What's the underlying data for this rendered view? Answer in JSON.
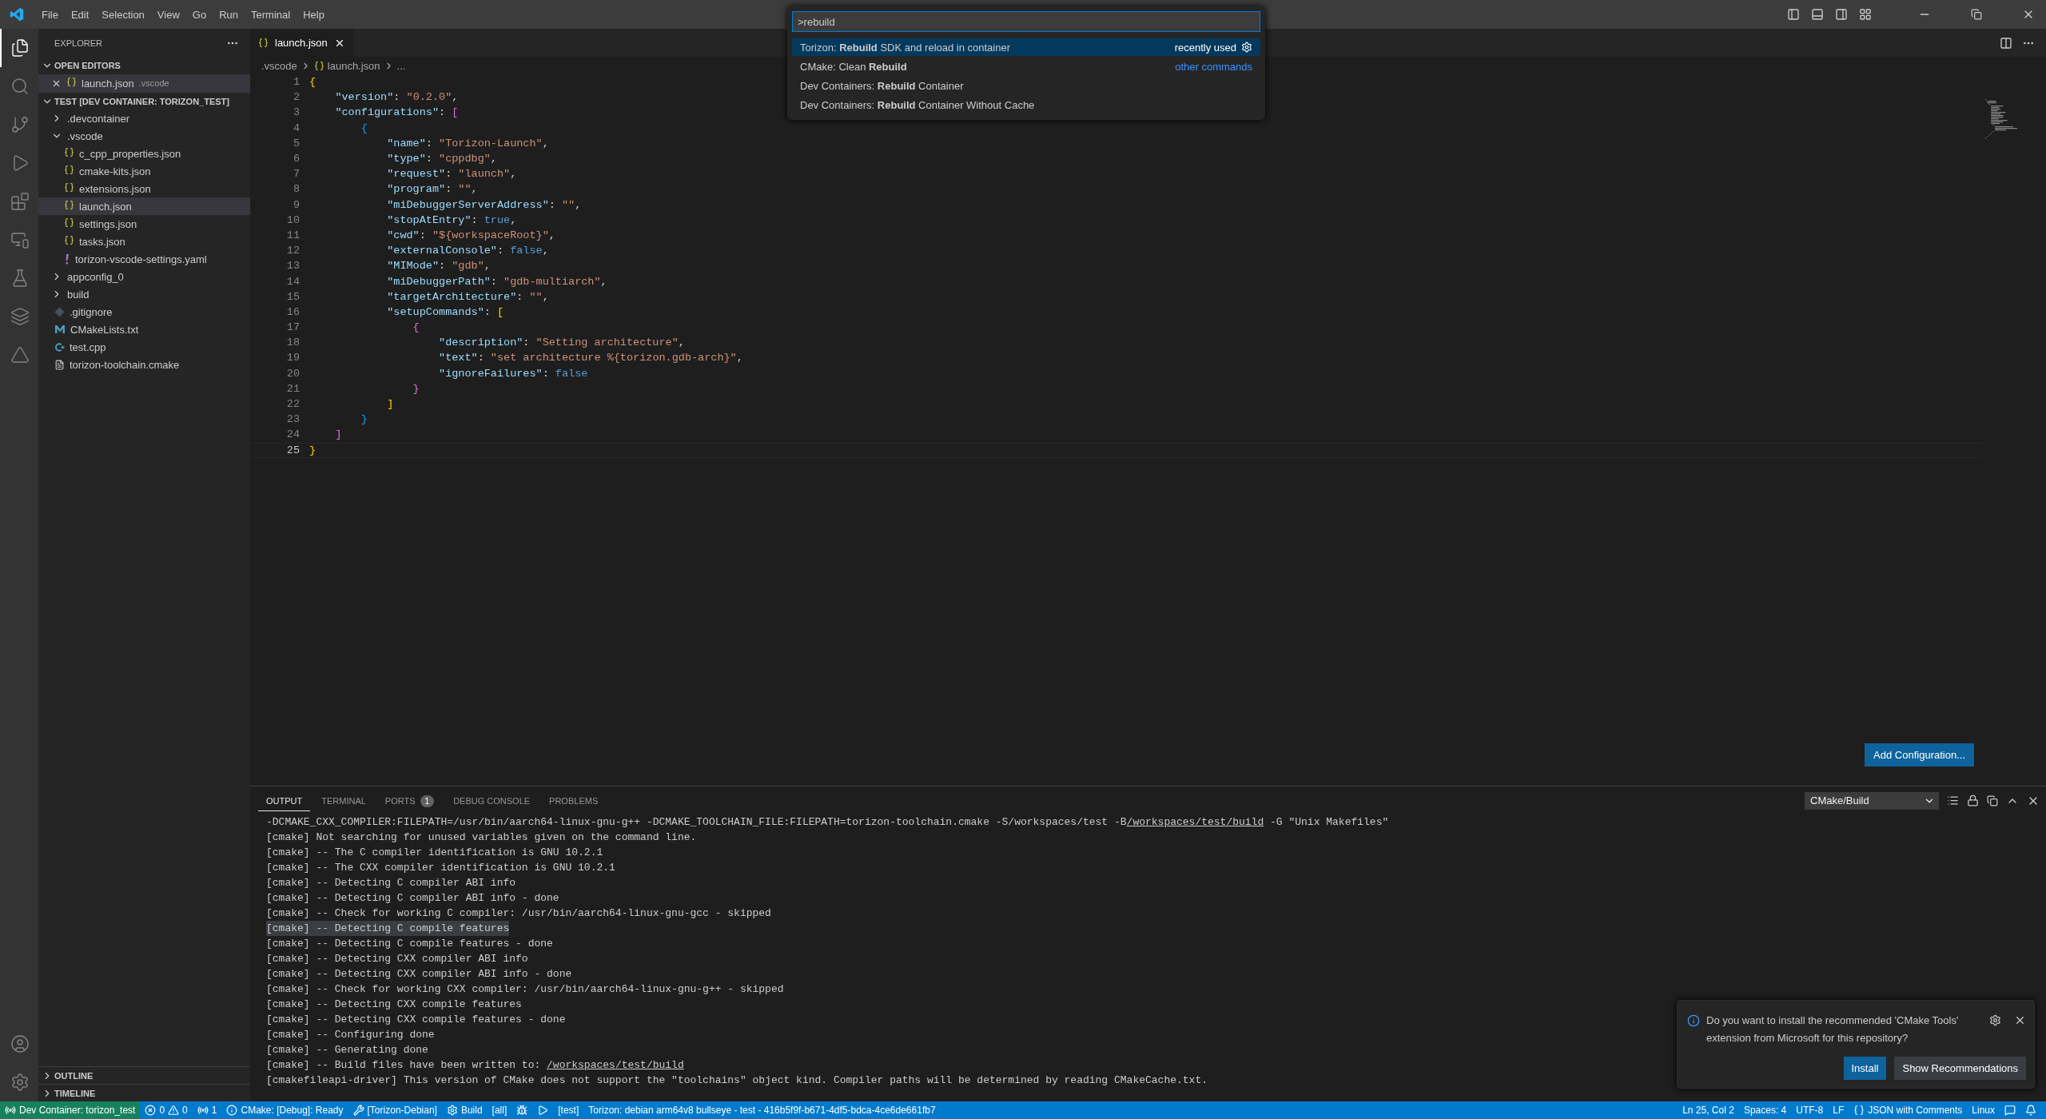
{
  "menu": [
    "File",
    "Edit",
    "Selection",
    "View",
    "Go",
    "Run",
    "Terminal",
    "Help"
  ],
  "activity_bar": {
    "top": [
      {
        "kind": "files",
        "selected": true
      },
      {
        "kind": "search",
        "selected": false
      },
      {
        "kind": "source-control",
        "selected": false
      },
      {
        "kind": "run-debug",
        "selected": false
      },
      {
        "kind": "extensions",
        "selected": false
      },
      {
        "kind": "remote",
        "selected": false
      },
      {
        "kind": "testing",
        "selected": false
      },
      {
        "kind": "stack",
        "selected": false
      },
      {
        "kind": "torizon",
        "selected": false
      }
    ],
    "bottom": [
      {
        "kind": "account"
      },
      {
        "kind": "settings"
      }
    ]
  },
  "sidebar": {
    "title": "EXPLORER",
    "open_editors": {
      "title": "OPEN EDITORS",
      "items": [
        {
          "name": "launch.json",
          "folder": ".vscode",
          "kind": "json"
        }
      ]
    },
    "folder": {
      "title": "TEST [DEV CONTAINER: TORIZON_TEST]",
      "items": [
        {
          "name": ".devcontainer",
          "kind": "folder",
          "expanded": false,
          "selected": false
        },
        {
          "name": ".vscode",
          "kind": "folder",
          "expanded": true,
          "selected": false,
          "children": [
            {
              "name": "c_cpp_properties.json",
              "kind": "json",
              "selected": false
            },
            {
              "name": "cmake-kits.json",
              "kind": "json",
              "selected": false
            },
            {
              "name": "extensions.json",
              "kind": "json",
              "selected": false
            },
            {
              "name": "launch.json",
              "kind": "json",
              "selected": true
            },
            {
              "name": "settings.json",
              "kind": "json",
              "selected": false
            },
            {
              "name": "tasks.json",
              "kind": "json",
              "selected": false
            },
            {
              "name": "torizon-vscode-settings.yaml",
              "kind": "yaml",
              "selected": false
            }
          ]
        },
        {
          "name": "appconfig_0",
          "kind": "folder",
          "expanded": false,
          "selected": false
        },
        {
          "name": "build",
          "kind": "folder",
          "expanded": false,
          "selected": false
        },
        {
          "name": ".gitignore",
          "kind": "git",
          "selected": false
        },
        {
          "name": "CMakeLists.txt",
          "kind": "cmake",
          "selected": false
        },
        {
          "name": "test.cpp",
          "kind": "cpp",
          "selected": false
        },
        {
          "name": "torizon-toolchain.cmake",
          "kind": "text",
          "selected": false
        }
      ]
    },
    "sections": [
      {
        "title": "OUTLINE",
        "expanded": false
      },
      {
        "title": "TIMELINE",
        "expanded": false
      }
    ]
  },
  "editor": {
    "tabs": [
      {
        "label": "launch.json",
        "selected": true
      }
    ],
    "breadcrumbs": [
      ".vscode",
      "launch.json",
      "..."
    ],
    "lines": [
      {
        "number": "1",
        "current": false,
        "tokens": [
          {
            "kind": "bracket",
            "color": "#ffd700",
            "text": "{"
          }
        ]
      },
      {
        "number": "2",
        "current": false,
        "tokens": [
          {
            "kind": "key",
            "text": "    \"version\""
          },
          {
            "kind": "punc",
            "text": ": "
          },
          {
            "kind": "str",
            "text": "\"0.2.0\""
          },
          {
            "kind": "punc",
            "text": ","
          }
        ]
      },
      {
        "number": "3",
        "current": false,
        "tokens": [
          {
            "kind": "key",
            "text": "    \"configurations\""
          },
          {
            "kind": "punc",
            "text": ": "
          },
          {
            "kind": "bracket",
            "color": "#da70d6",
            "text": "["
          }
        ]
      },
      {
        "number": "4",
        "current": false,
        "tokens": [
          {
            "kind": "bracket",
            "color": "#179fff",
            "text": "        {"
          }
        ]
      },
      {
        "number": "5",
        "current": false,
        "tokens": [
          {
            "kind": "key",
            "text": "            \"name\""
          },
          {
            "kind": "punc",
            "text": ": "
          },
          {
            "kind": "str",
            "text": "\"Torizon-Launch\""
          },
          {
            "kind": "punc",
            "text": ","
          }
        ]
      },
      {
        "number": "6",
        "current": false,
        "tokens": [
          {
            "kind": "key",
            "text": "            \"type\""
          },
          {
            "kind": "punc",
            "text": ": "
          },
          {
            "kind": "str",
            "text": "\"cppdbg\""
          },
          {
            "kind": "punc",
            "text": ","
          }
        ]
      },
      {
        "number": "7",
        "current": false,
        "tokens": [
          {
            "kind": "key",
            "text": "            \"request\""
          },
          {
            "kind": "punc",
            "text": ": "
          },
          {
            "kind": "str",
            "text": "\"launch\""
          },
          {
            "kind": "punc",
            "text": ","
          }
        ]
      },
      {
        "number": "8",
        "current": false,
        "tokens": [
          {
            "kind": "key",
            "text": "            \"program\""
          },
          {
            "kind": "punc",
            "text": ": "
          },
          {
            "kind": "str",
            "text": "\"\""
          },
          {
            "kind": "punc",
            "text": ","
          }
        ]
      },
      {
        "number": "9",
        "current": false,
        "tokens": [
          {
            "kind": "key",
            "text": "            \"miDebuggerServerAddress\""
          },
          {
            "kind": "punc",
            "text": ": "
          },
          {
            "kind": "str",
            "text": "\"\""
          },
          {
            "kind": "punc",
            "text": ","
          }
        ]
      },
      {
        "number": "10",
        "current": false,
        "tokens": [
          {
            "kind": "key",
            "text": "            \"stopAtEntry\""
          },
          {
            "kind": "punc",
            "text": ": "
          },
          {
            "kind": "kw",
            "text": "true"
          },
          {
            "kind": "punc",
            "text": ","
          }
        ]
      },
      {
        "number": "11",
        "current": false,
        "tokens": [
          {
            "kind": "key",
            "text": "            \"cwd\""
          },
          {
            "kind": "punc",
            "text": ": "
          },
          {
            "kind": "str",
            "text": "\"${workspaceRoot}\""
          },
          {
            "kind": "punc",
            "text": ","
          }
        ]
      },
      {
        "number": "12",
        "current": false,
        "tokens": [
          {
            "kind": "key",
            "text": "            \"externalConsole\""
          },
          {
            "kind": "punc",
            "text": ": "
          },
          {
            "kind": "kw",
            "text": "false"
          },
          {
            "kind": "punc",
            "text": ","
          }
        ]
      },
      {
        "number": "13",
        "current": false,
        "tokens": [
          {
            "kind": "key",
            "text": "            \"MIMode\""
          },
          {
            "kind": "punc",
            "text": ": "
          },
          {
            "kind": "str",
            "text": "\"gdb\""
          },
          {
            "kind": "punc",
            "text": ","
          }
        ]
      },
      {
        "number": "14",
        "current": false,
        "tokens": [
          {
            "kind": "key",
            "text": "            \"miDebuggerPath\""
          },
          {
            "kind": "punc",
            "text": ": "
          },
          {
            "kind": "str",
            "text": "\"gdb-multiarch\""
          },
          {
            "kind": "punc",
            "text": ","
          }
        ]
      },
      {
        "number": "15",
        "current": false,
        "tokens": [
          {
            "kind": "key",
            "text": "            \"targetArchitecture\""
          },
          {
            "kind": "punc",
            "text": ": "
          },
          {
            "kind": "str",
            "text": "\"\""
          },
          {
            "kind": "punc",
            "text": ","
          }
        ]
      },
      {
        "number": "16",
        "current": false,
        "tokens": [
          {
            "kind": "key",
            "text": "            \"setupCommands\""
          },
          {
            "kind": "punc",
            "text": ": "
          },
          {
            "kind": "bracket",
            "color": "#ffd700",
            "text": "["
          }
        ]
      },
      {
        "number": "17",
        "current": false,
        "tokens": [
          {
            "kind": "bracket",
            "color": "#da70d6",
            "text": "                {"
          }
        ]
      },
      {
        "number": "18",
        "current": false,
        "tokens": [
          {
            "kind": "key",
            "text": "                    \"description\""
          },
          {
            "kind": "punc",
            "text": ": "
          },
          {
            "kind": "str",
            "text": "\"Setting architecture\""
          },
          {
            "kind": "punc",
            "text": ","
          }
        ]
      },
      {
        "number": "19",
        "current": false,
        "tokens": [
          {
            "kind": "key",
            "text": "                    \"text\""
          },
          {
            "kind": "punc",
            "text": ": "
          },
          {
            "kind": "str",
            "text": "\"set architecture %{torizon.gdb-arch}\""
          },
          {
            "kind": "punc",
            "text": ","
          }
        ]
      },
      {
        "number": "20",
        "current": false,
        "tokens": [
          {
            "kind": "key",
            "text": "                    \"ignoreFailures\""
          },
          {
            "kind": "punc",
            "text": ": "
          },
          {
            "kind": "kw",
            "text": "false"
          }
        ]
      },
      {
        "number": "21",
        "current": false,
        "tokens": [
          {
            "kind": "bracket",
            "color": "#da70d6",
            "text": "                }"
          }
        ]
      },
      {
        "number": "22",
        "current": false,
        "tokens": [
          {
            "kind": "bracket",
            "color": "#ffd700",
            "text": "            ]"
          }
        ]
      },
      {
        "number": "23",
        "current": false,
        "tokens": [
          {
            "kind": "bracket",
            "color": "#179fff",
            "text": "        }"
          }
        ]
      },
      {
        "number": "24",
        "current": false,
        "tokens": [
          {
            "kind": "bracket",
            "color": "#da70d6",
            "text": "    ]"
          }
        ]
      },
      {
        "number": "25",
        "current": true,
        "tokens": [
          {
            "kind": "bracket",
            "color": "#ffd700",
            "text": "}"
          }
        ]
      }
    ],
    "add_configuration": "Add Configuration..."
  },
  "command_palette": {
    "value": ">rebuild",
    "items": [
      {
        "label": "Torizon: **Rebuild** SDK and reload in container",
        "selected": true,
        "note": "recently used"
      },
      {
        "label": "CMake: Clean **Rebuild**",
        "selected": false,
        "note": "other commands"
      },
      {
        "label": "Dev Containers: **Rebuild** Container",
        "selected": false
      },
      {
        "label": "Dev Containers: **Rebuild** Container Without Cache",
        "selected": false
      }
    ]
  },
  "panel": {
    "tabs": [
      {
        "label": "OUTPUT",
        "selected": true
      },
      {
        "label": "TERMINAL",
        "selected": false
      },
      {
        "label": "PORTS",
        "selected": false,
        "badge": "1"
      },
      {
        "label": "DEBUG CONSOLE",
        "selected": false
      },
      {
        "label": "PROBLEMS",
        "selected": false
      }
    ],
    "channel": "CMake/Build",
    "lines": [
      {
        "highlighted": false,
        "segments": [
          {
            "kind": "plain",
            "text": "-DCMAKE_CXX_COMPILER:FILEPATH=/usr/bin/aarch64-linux-gnu-g++ -DCMAKE_TOOLCHAIN_FILE:FILEPATH=torizon-toolchain.cmake -S/workspaces/test -B"
          },
          {
            "kind": "link",
            "text": "/workspaces/test/build"
          },
          {
            "kind": "plain",
            "text": " -G \"Unix Makefiles\""
          }
        ]
      },
      {
        "highlighted": false,
        "segments": [
          {
            "kind": "plain",
            "text": "[cmake] Not searching for unused variables given on the command line."
          }
        ]
      },
      {
        "highlighted": false,
        "segments": [
          {
            "kind": "plain",
            "text": "[cmake] -- The C compiler identification is GNU 10.2.1"
          }
        ]
      },
      {
        "highlighted": false,
        "segments": [
          {
            "kind": "plain",
            "text": "[cmake] -- The CXX compiler identification is GNU 10.2.1"
          }
        ]
      },
      {
        "highlighted": false,
        "segments": [
          {
            "kind": "plain",
            "text": "[cmake] -- Detecting C compiler ABI info"
          }
        ]
      },
      {
        "highlighted": false,
        "segments": [
          {
            "kind": "plain",
            "text": "[cmake] -- Detecting C compiler ABI info - done"
          }
        ]
      },
      {
        "highlighted": false,
        "segments": [
          {
            "kind": "plain",
            "text": "[cmake] -- Check for working C compiler: /usr/bin/aarch64-linux-gnu-gcc - skipped"
          }
        ]
      },
      {
        "highlighted": true,
        "segments": [
          {
            "kind": "plain",
            "text": "[cmake] -- Detecting C compile features"
          }
        ]
      },
      {
        "highlighted": false,
        "segments": [
          {
            "kind": "plain",
            "text": "[cmake] -- Detecting C compile features - done"
          }
        ]
      },
      {
        "highlighted": false,
        "segments": [
          {
            "kind": "plain",
            "text": "[cmake] -- Detecting CXX compiler ABI info"
          }
        ]
      },
      {
        "highlighted": false,
        "segments": [
          {
            "kind": "plain",
            "text": "[cmake] -- Detecting CXX compiler ABI info - done"
          }
        ]
      },
      {
        "highlighted": false,
        "segments": [
          {
            "kind": "plain",
            "text": "[cmake] -- Check for working CXX compiler: /usr/bin/aarch64-linux-gnu-g++ - skipped"
          }
        ]
      },
      {
        "highlighted": false,
        "segments": [
          {
            "kind": "plain",
            "text": "[cmake] -- Detecting CXX compile features"
          }
        ]
      },
      {
        "highlighted": false,
        "segments": [
          {
            "kind": "plain",
            "text": "[cmake] -- Detecting CXX compile features - done"
          }
        ]
      },
      {
        "highlighted": false,
        "segments": [
          {
            "kind": "plain",
            "text": "[cmake] -- Configuring done"
          }
        ]
      },
      {
        "highlighted": false,
        "segments": [
          {
            "kind": "plain",
            "text": "[cmake] -- Generating done"
          }
        ]
      },
      {
        "highlighted": false,
        "segments": [
          {
            "kind": "plain",
            "text": "[cmake] -- Build files have been written to: "
          },
          {
            "kind": "link",
            "text": "/workspaces/test/build"
          }
        ]
      },
      {
        "highlighted": false,
        "segments": [
          {
            "kind": "plain",
            "text": "[cmakefileapi-driver] This version of CMake does not support the \"toolchains\" object kind. Compiler paths will be determined by reading CMakeCache.txt."
          }
        ]
      }
    ]
  },
  "notification": {
    "message": "Do you want to install the recommended 'CMake Tools' extension from Microsoft for this repository?",
    "buttons": [
      {
        "label": "Install",
        "kind": "primary"
      },
      {
        "label": "Show Recommendations",
        "kind": "secondary"
      }
    ]
  },
  "status_bar": {
    "left": [
      {
        "kind": "remote",
        "text": "Dev Container: torizon_test"
      },
      {
        "kind": "problems",
        "errors": "0",
        "warnings": "0"
      },
      {
        "kind": "ports",
        "text": "1"
      },
      {
        "kind": "info",
        "text": "CMake: [Debug]: Ready"
      },
      {
        "kind": "tools",
        "text": "[Torizon-Debian]"
      },
      {
        "kind": "gear",
        "text": "Build"
      },
      {
        "kind": "plain",
        "text": "[all]"
      },
      {
        "kind": "bug"
      },
      {
        "kind": "play"
      },
      {
        "kind": "plain",
        "text": "[test]"
      },
      {
        "kind": "plain",
        "text": "Torizon: debian arm64v8 bullseye - test - 416b5f9f-b671-4df5-bdca-4ce6de661fb7"
      }
    ],
    "right": [
      {
        "kind": "plain",
        "text": "Ln 25, Col 2"
      },
      {
        "kind": "plain",
        "text": "Spaces: 4"
      },
      {
        "kind": "plain",
        "text": "UTF-8"
      },
      {
        "kind": "plain",
        "text": "LF"
      },
      {
        "kind": "braces",
        "text": "JSON with Comments"
      },
      {
        "kind": "plain",
        "text": "Linux"
      },
      {
        "kind": "feedback"
      },
      {
        "kind": "bell"
      }
    ]
  }
}
